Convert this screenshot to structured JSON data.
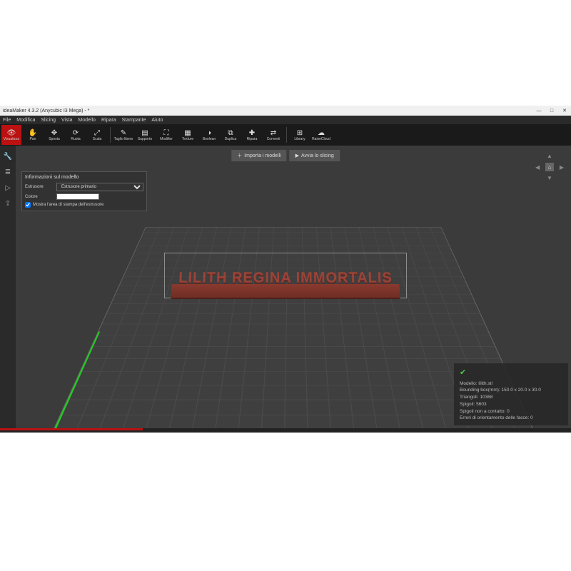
{
  "titlebar": {
    "title": "ideaMaker 4.3.2 (Anycubic I3 Mega) - *"
  },
  "win_controls": {
    "min": "—",
    "max": "□",
    "close": "✕"
  },
  "menu": [
    "File",
    "Modifica",
    "Slicing",
    "Vista",
    "Modello",
    "Ripara",
    "Stampante",
    "Aiuto"
  ],
  "tools": [
    {
      "label": "Visualizza",
      "icon": "👁",
      "active": true
    },
    {
      "label": "Pan",
      "icon": "✋"
    },
    {
      "label": "Sposta",
      "icon": "✥"
    },
    {
      "label": "Ruota",
      "icon": "⟳"
    },
    {
      "label": "Scala",
      "icon": "⤢"
    },
    {
      "label": "Taglio libero",
      "icon": "✎"
    },
    {
      "label": "Supporto",
      "icon": "▤"
    },
    {
      "label": "Modifier",
      "icon": "⛶"
    },
    {
      "label": "Texture",
      "icon": "▦"
    },
    {
      "label": "Boolean",
      "icon": "◑"
    },
    {
      "label": "Duplica",
      "icon": "⧉"
    },
    {
      "label": "Ripara",
      "icon": "✚"
    },
    {
      "label": "Converti",
      "icon": "⇄"
    },
    {
      "label": "Library",
      "icon": "⊞"
    },
    {
      "label": "RaiseCloud",
      "icon": "☁"
    }
  ],
  "top_actions": {
    "import": "Importa i modelli",
    "slice": "Avvia lo slicing"
  },
  "left_icons": [
    "wrench",
    "layers",
    "play",
    "export"
  ],
  "info_panel": {
    "title": "Informazioni sul modello",
    "extruder_label": "Estrusore",
    "extruder_value": "Estrusore primario",
    "color_label": "Colore",
    "show_area_label": "Mostra l'area di stampa dell'estrusore"
  },
  "model": {
    "text": "LILITH REGINA IMMORTALIS"
  },
  "status": {
    "model_label": "Modello:",
    "model_value": "lilith.stl",
    "bbox_label": "Bounding box(mm):",
    "bbox_value": "150.0 x 20.0 x 30.0",
    "tri_label": "Triangoli:",
    "tri_value": "10368",
    "edge_label": "Spigoli:",
    "edge_value": "5603",
    "nm_label": "Spigoli non a contatto:",
    "nm_value": "0",
    "orient_label": "Errori di orientamento delle facce:",
    "orient_value": "0"
  },
  "viewcube": {
    "home": "⌂"
  }
}
